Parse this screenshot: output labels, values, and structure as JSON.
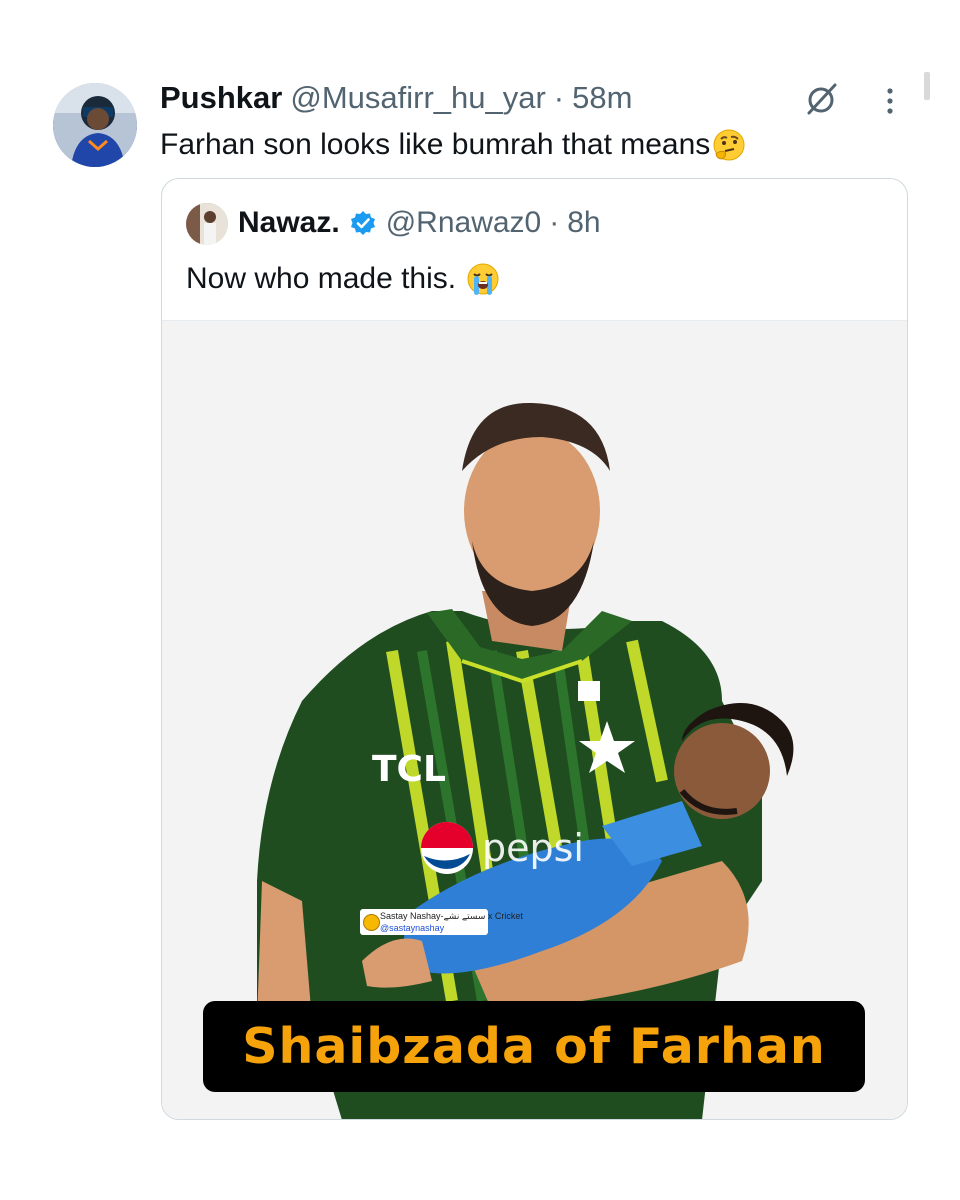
{
  "tweet": {
    "display_name": "Pushkar",
    "handle": "@Musafirr_hu_yar",
    "separator": "·",
    "time": "58m",
    "text": "Farhan son looks like bumrah that means",
    "emoji": "thinking-face"
  },
  "quoted_tweet": {
    "display_name": "Nawaz.",
    "verified": true,
    "handle": "@Rnawaz0",
    "separator": "·",
    "time": "8h",
    "text": "Now who made this.",
    "emoji": "loudly-crying-face",
    "media": {
      "caption": "Shaibzada of Farhan",
      "jersey_text": "TCL",
      "sponsor_text": "pepsi",
      "watermark_line1": "Sastay Nashay-سستے نشے x Cricket",
      "watermark_line2": "@sastaynashay"
    }
  },
  "icons": {
    "grok": "grok-icon",
    "more": "more-vertical-icon",
    "verified": "verified-badge-icon"
  },
  "colors": {
    "text_primary": "#0f1419",
    "text_secondary": "#536471",
    "verified_blue": "#1d9bf0",
    "caption_orange": "#f6a20a",
    "jersey_green": "#1f4d20",
    "jersey_lime": "#c8e02a"
  }
}
